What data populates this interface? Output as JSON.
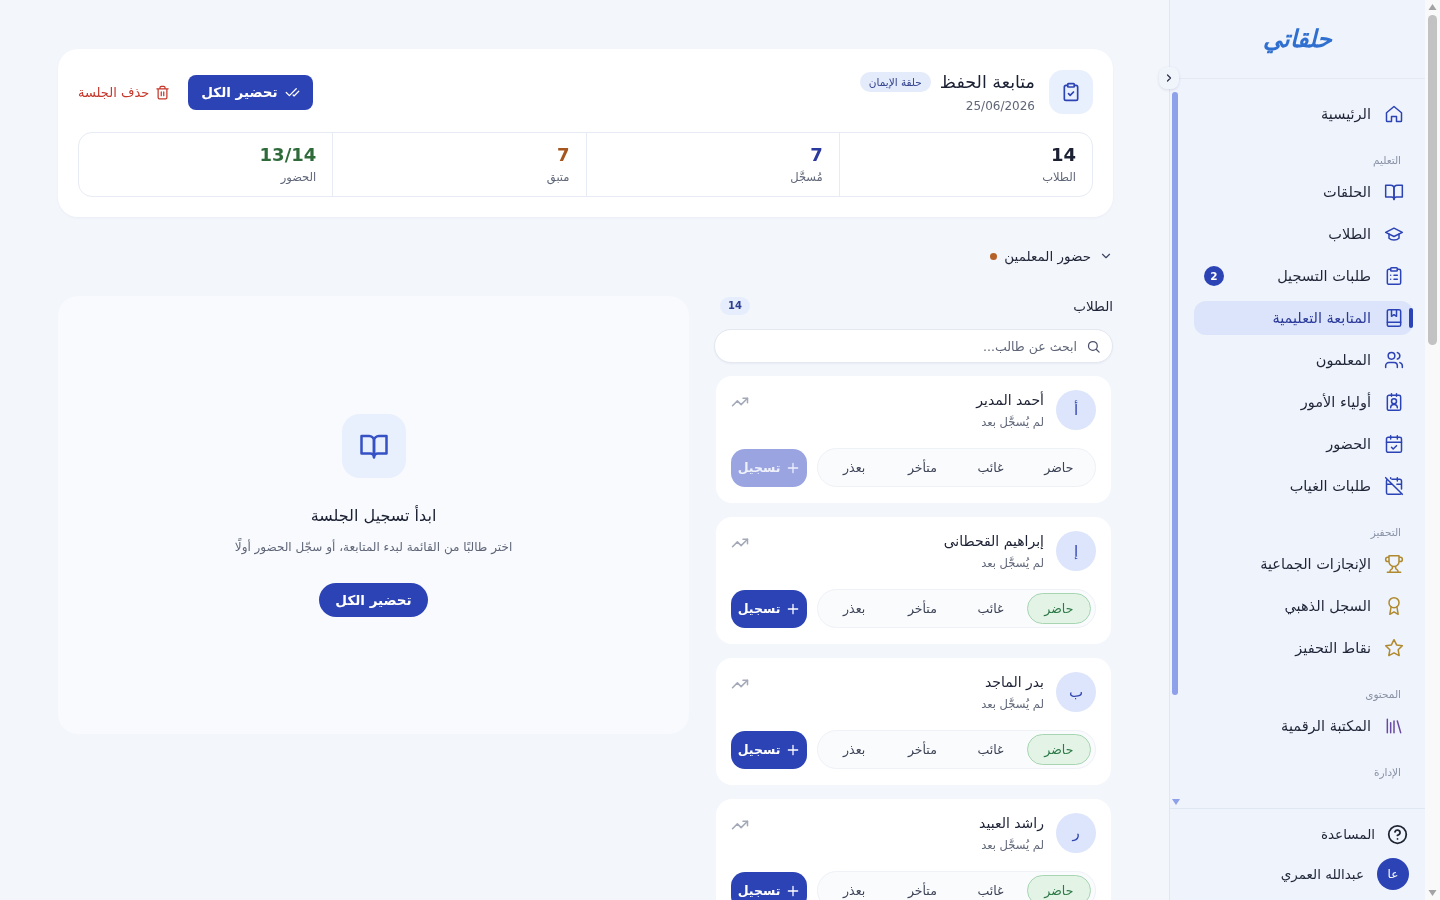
{
  "sidebar": {
    "logo": "حلقاتي",
    "groups": [
      {
        "items": [
          {
            "label": "الرئيسية",
            "selected": false
          }
        ]
      },
      {
        "heading": "التعليم",
        "items": [
          {
            "label": "الحلقات",
            "selected": false
          },
          {
            "label": "الطلاب",
            "selected": false
          },
          {
            "label": "طلبات التسجيل",
            "selected": false,
            "badge": "2"
          },
          {
            "label": "المتابعة التعليمية",
            "selected": true
          },
          {
            "label": "المعلمون",
            "selected": false
          },
          {
            "label": "أولياء الأمور",
            "selected": false
          },
          {
            "label": "الحضور",
            "selected": false
          },
          {
            "label": "طلبات الغياب",
            "selected": false
          }
        ]
      },
      {
        "heading": "التحفيز",
        "items": [
          {
            "label": "الإنجازات الجماعية",
            "selected": false
          },
          {
            "label": "السجل الذهبي",
            "selected": false
          },
          {
            "label": "نقاط التحفيز",
            "selected": false
          }
        ]
      },
      {
        "heading": "المحتوى",
        "items": [
          {
            "label": "المكتبة الرقمية",
            "selected": false
          }
        ]
      },
      {
        "heading": "الإدارة"
      }
    ],
    "help": "المساعدة",
    "user": {
      "initials": "عا",
      "name": "عبدالله العمري"
    }
  },
  "session": {
    "title": "متابعة الحفظ",
    "circle": "حلقة الإيمان",
    "date": "25/06/2026",
    "mark_all_button": "تحضير الكل",
    "delete_button": "حذف الجلسة",
    "stats": [
      {
        "value": "14",
        "label": "الطلاب",
        "color": "#1c2033"
      },
      {
        "value": "7",
        "label": "مُسجَّل",
        "color": "#2a3a9c"
      },
      {
        "value": "7",
        "label": "متبق",
        "color": "#a5561f"
      },
      {
        "value": "13/14",
        "label": "الحضور",
        "color": "#2f6b3a"
      }
    ]
  },
  "teacher_attendance": {
    "label": "حضور المعلمين",
    "expanded": false,
    "color": "#b5622a"
  },
  "students": {
    "title": "الطلاب",
    "count": "14",
    "search": {
      "placeholder": "ابحث عن طالب..."
    },
    "items": [
      {
        "initial": "أ",
        "name": "أحمد المدير",
        "status": "لم يُسجَّل بعد",
        "options": [
          {
            "label": "حاضر",
            "selected": false
          },
          {
            "label": "غائب",
            "selected": false
          },
          {
            "label": "متأخر",
            "selected": false
          },
          {
            "label": "بعذر",
            "selected": false
          }
        ],
        "record_button": {
          "label": "تسجيل",
          "disabled": true
        }
      },
      {
        "initial": "إ",
        "name": "إبراهيم القحطانى",
        "status": "لم يُسجَّل بعد",
        "options": [
          {
            "label": "حاضر",
            "selected": true
          },
          {
            "label": "غائب",
            "selected": false
          },
          {
            "label": "متأخر",
            "selected": false
          },
          {
            "label": "بعذر",
            "selected": false
          }
        ],
        "record_button": {
          "label": "تسجيل",
          "disabled": false
        }
      },
      {
        "initial": "ب",
        "name": "بدر الماجد",
        "status": "لم يُسجَّل بعد",
        "options": [
          {
            "label": "حاضر",
            "selected": true
          },
          {
            "label": "غائب",
            "selected": false
          },
          {
            "label": "متأخر",
            "selected": false
          },
          {
            "label": "بعذر",
            "selected": false
          }
        ],
        "record_button": {
          "label": "تسجيل",
          "disabled": false
        }
      },
      {
        "initial": "ر",
        "name": "راشد العبيد",
        "status": "لم يُسجَّل بعد",
        "options": [
          {
            "label": "حاضر",
            "selected": true
          },
          {
            "label": "غائب",
            "selected": false
          },
          {
            "label": "متأخر",
            "selected": false
          },
          {
            "label": "بعذر",
            "selected": false
          }
        ],
        "record_button": {
          "label": "تسجيل",
          "disabled": false
        }
      }
    ]
  },
  "empty_state": {
    "title": "ابدأ تسجيل الجلسة",
    "description": "اختر طالبًا من القائمة لبدء المتابعة، أو سجّل الحضور أولًا",
    "button": "تحضير الكل"
  }
}
